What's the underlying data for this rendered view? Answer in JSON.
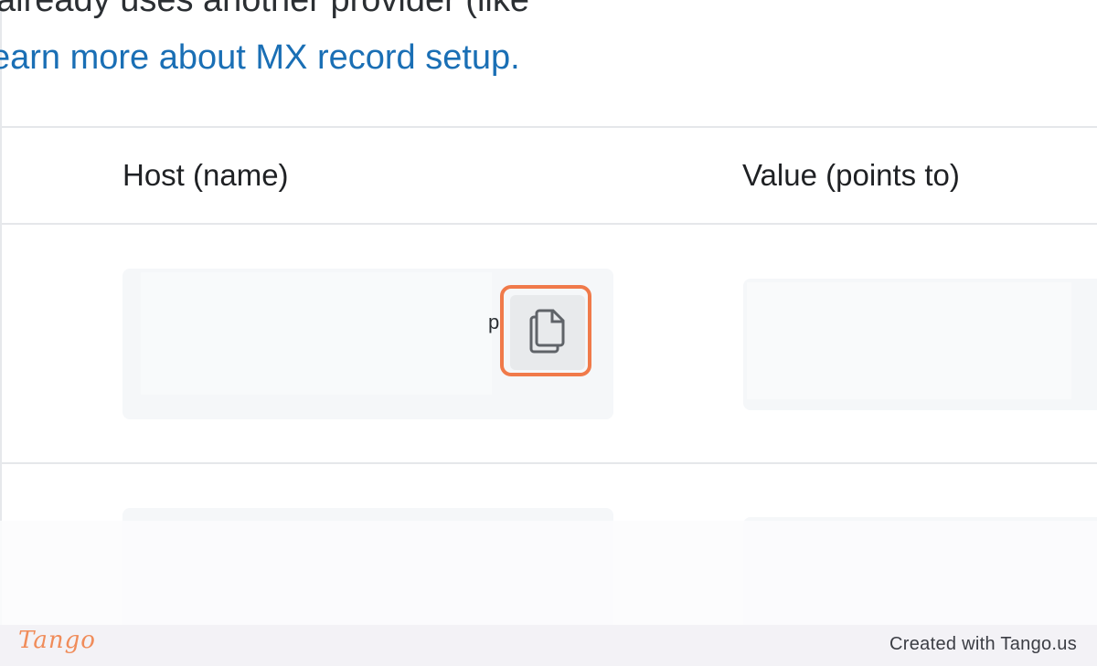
{
  "intro": {
    "line1": "already uses another provider (like",
    "link": "earn more about MX record setup."
  },
  "table": {
    "headers": {
      "host": "Host (name)",
      "value": "Value (points to)"
    },
    "rows": [
      {
        "host_value_visible_tail": "p",
        "copy_icon": "copy-icon"
      }
    ]
  },
  "footer": {
    "logo": "Tango",
    "credit": "Created with Tango.us"
  },
  "colors": {
    "link": "#1a6fb5",
    "highlight": "#f07a4a",
    "brand": "#f08c5a"
  }
}
